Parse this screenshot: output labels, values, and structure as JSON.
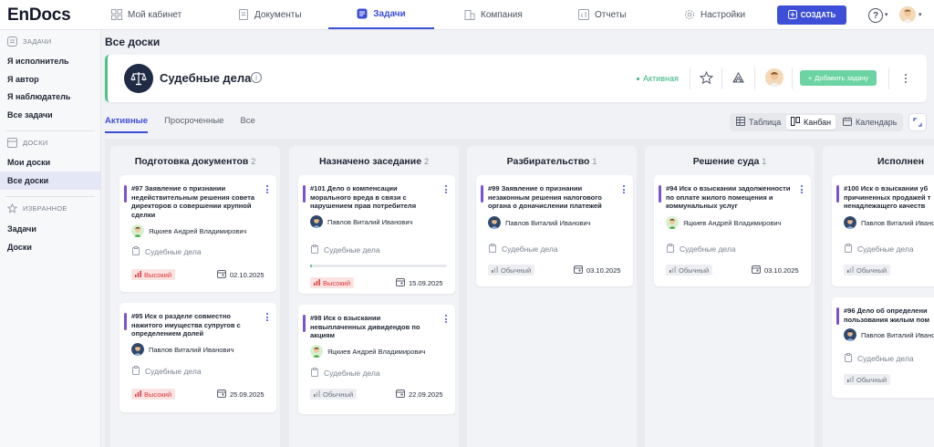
{
  "app": {
    "logo": "EnDocs"
  },
  "nav": [
    {
      "label": "Мой кабинет",
      "icon": "grid-icon"
    },
    {
      "label": "Документы",
      "icon": "document-icon"
    },
    {
      "label": "Задачи",
      "icon": "tasks-icon",
      "active": true
    },
    {
      "label": "Компания",
      "icon": "building-icon"
    },
    {
      "label": "Отчеты",
      "icon": "chart-icon"
    },
    {
      "label": "Настройки",
      "icon": "gear-icon"
    }
  ],
  "create_label": "СОЗДАТЬ",
  "help_label": "?",
  "sidebar": {
    "tasks_section": "ЗАДАЧИ",
    "tasks_items": [
      "Я исполнитель",
      "Я автор",
      "Я наблюдатель",
      "Все задачи"
    ],
    "boards_section": "ДОСКИ",
    "boards_items": [
      "Мои доски",
      "Все доски"
    ],
    "favorites_section": "ИЗБРАННОЕ",
    "favorites_items": [
      "Задачи",
      "Доски"
    ]
  },
  "page_title": "Все доски",
  "board": {
    "name": "Судебные дела",
    "status": "Активная",
    "add_task_label": "Добавить задачу",
    "accent_color": "#4cc38a"
  },
  "tabs": [
    "Активные",
    "Просроченные",
    "Все"
  ],
  "views": [
    "Таблица",
    "Канбан",
    "Календарь"
  ],
  "columns": [
    {
      "title": "Подготовка документов",
      "count": "2",
      "cards": [
        {
          "title": "#97 Заявление о признании недействительным решения совета директоров о совершении крупной сделки",
          "assignee": "Яцкиев Андрей Владимирович",
          "board": "Судебные дела",
          "priority": "Высокий",
          "date": "02.10.2025"
        },
        {
          "title": "#95 Иск о разделе совместно нажитого имущества супругов с определением долей",
          "assignee": "Павлов Виталий Иванович",
          "board": "Судебные дела",
          "priority": "Высокий",
          "date": "25.09.2025"
        }
      ]
    },
    {
      "title": "Назначено заседание",
      "count": "2",
      "cards": [
        {
          "title": "#101 Дело о компенсации морального вреда в связи с нарушением прав потребителя",
          "assignee": "Павлов Виталий Иванович",
          "board": "Судебные дела",
          "priority": "Высокий",
          "date": "15.09.2025",
          "progress": 0.01
        },
        {
          "title": "#98 Иск о взыскании невыплаченных дивидендов по акциям",
          "assignee": "Яцкиев Андрей Владимирович",
          "board": "Судебные дела",
          "priority": "Обычный",
          "date": "22.09.2025"
        }
      ]
    },
    {
      "title": "Разбирательство",
      "count": "1",
      "cards": [
        {
          "title": "#99 Заявление о признании незаконным решения налогового органа о доначислении платежей",
          "assignee": "Павлов Виталий Иванович",
          "board": "Судебные дела",
          "priority": "Обычный",
          "date": "03.10.2025"
        }
      ]
    },
    {
      "title": "Решение суда",
      "count": "1",
      "cards": [
        {
          "title": "#94 Иск о взыскании задолженности по оплате жилого помещения и коммунальных услуг",
          "assignee": "Яцкиев Андрей Владимирович",
          "board": "Судебные дела",
          "priority": "Обычный",
          "date": "03.10.2025"
        }
      ]
    },
    {
      "title": "Исполнен",
      "cards": [
        {
          "title": "#100 Иск о взыскании уб причиненных продажей т ненадлежащего качеств",
          "assignee": "Павлов Виталий Иванович",
          "board": "Судебные дела",
          "priority": "Обычный"
        },
        {
          "title": "#96 Дело об определени пользования жилым пом",
          "assignee": "Павлов Виталий Иванович",
          "board": "Судебные дела",
          "priority": "Обычный"
        }
      ]
    }
  ]
}
